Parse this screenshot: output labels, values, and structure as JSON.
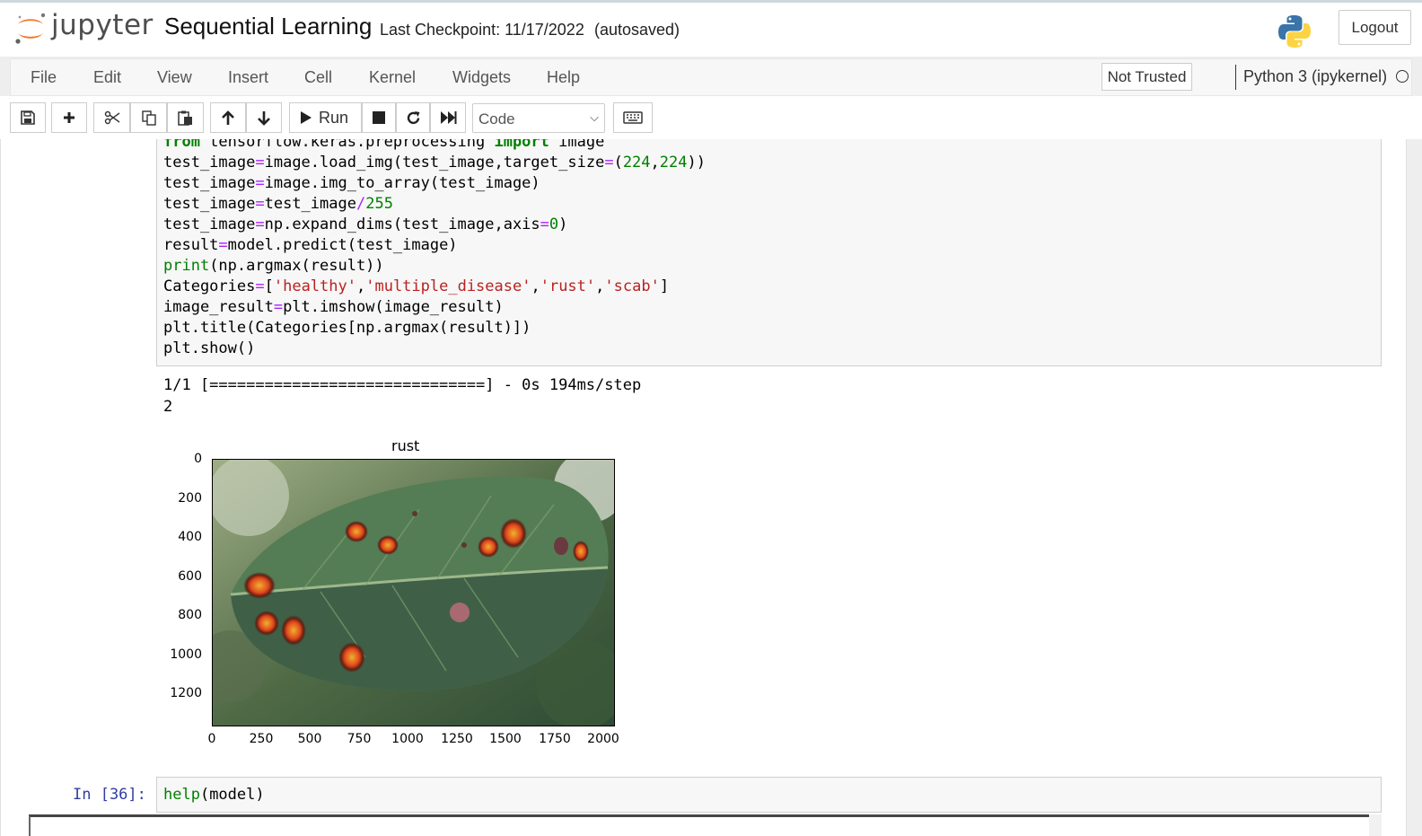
{
  "header": {
    "logo_text": "jupyter",
    "notebook_title": "Sequential Learning",
    "checkpoint": "Last Checkpoint: 11/17/2022",
    "autosave_status": "(autosaved)",
    "logout_label": "Logout"
  },
  "menu": {
    "items": [
      "File",
      "Edit",
      "View",
      "Insert",
      "Cell",
      "Kernel",
      "Widgets",
      "Help"
    ],
    "trust_status": "Not Trusted",
    "kernel_name": "Python 3 (ipykernel)"
  },
  "toolbar": {
    "run_label": "Run",
    "cell_type": "Code",
    "icons": [
      "save-icon",
      "plus-icon",
      "scissors-icon",
      "copy-icon",
      "paste-icon",
      "arrow-up-icon",
      "arrow-down-icon",
      "play-icon",
      "stop-icon",
      "restart-icon",
      "fast-forward-icon",
      "keyboard-icon"
    ]
  },
  "cell1": {
    "code_lines": [
      "from tensorflow.keras.preprocessing import image",
      "test_image=image.load_img(test_image,target_size=(224,224))",
      "test_image=image.img_to_array(test_image)",
      "test_image=test_image/255",
      "test_image=np.expand_dims(test_image,axis=0)",
      "result=model.predict(test_image)",
      "print(np.argmax(result))",
      "Categories=['healthy','multiple_disease','rust','scab']",
      "image_result=plt.imshow(image_result)",
      "plt.title(Categories[np.argmax(result)])",
      "plt.show()"
    ],
    "output_lines": [
      "1/1 [==============================] - 0s 194ms/step",
      "2"
    ],
    "plot": {
      "title": "rust",
      "yticks": [
        "0",
        "200",
        "400",
        "600",
        "800",
        "1000",
        "1200"
      ],
      "xticks": [
        "0",
        "250",
        "500",
        "750",
        "1000",
        "1250",
        "1500",
        "1750",
        "2000"
      ]
    }
  },
  "cell2": {
    "prompt": "In [36]:",
    "code": "help(model)"
  }
}
